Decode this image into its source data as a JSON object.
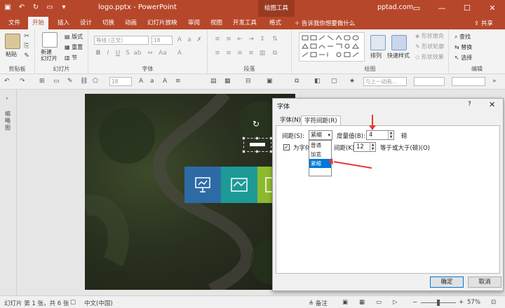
{
  "titlebar": {
    "title": "logo.pptx  -  PowerPoint",
    "context_tool": "绘图工具",
    "account": "pptad.com",
    "accent": "#b7472a"
  },
  "tabs": [
    "文件",
    "开始",
    "插入",
    "设计",
    "切换",
    "动画",
    "幻灯片放映",
    "审阅",
    "视图",
    "开发工具",
    "格式"
  ],
  "active_tab": "开始",
  "tell_me": "告诉我你想要做什么",
  "share": "共享",
  "ribbon": {
    "clipboard": {
      "label": "剪贴板",
      "paste": "粘贴"
    },
    "slides": {
      "label": "幻灯片",
      "new_slide": "新建\n幻灯片",
      "layout": "版式",
      "reset": "重置",
      "section": "节"
    },
    "font": {
      "label": "字体",
      "font_name": "等线 (正文)",
      "font_size": "18"
    },
    "paragraph": {
      "label": "段落"
    },
    "drawing": {
      "label": "绘图",
      "arrange": "排列",
      "quick_styles": "快速样式",
      "fill": "形状填充",
      "outline": "形状轮廓",
      "effects": "形状效果"
    },
    "editing": {
      "label": "编辑",
      "find": "查找",
      "replace": "替换",
      "select": "选择"
    }
  },
  "toolbar2": {
    "font_size": "18",
    "animation": "与上一动画..."
  },
  "left_pane_label": "缩略图",
  "dialog": {
    "title": "字体",
    "help": "?",
    "close": "✕",
    "tabs": [
      "字体(N)",
      "字符间距(R)"
    ],
    "active_tab": "字符间距(R)",
    "spacing_label": "间距(S):",
    "spacing_value": "紧缩",
    "spacing_options": [
      "普通",
      "加宽",
      "紧缩"
    ],
    "highlighted_option": "紧缩",
    "measure_label": "度量值(B):",
    "measure_value": "4",
    "measure_unit": "磅",
    "kerning_label": "为字体",
    "kerning_label2": "间距(K):",
    "kerning_checked": true,
    "kerning_value": "12",
    "kerning_suffix": "等于或大于(磅)(O)",
    "ok": "确定",
    "cancel": "取消"
  },
  "status": {
    "slide_info": "幻灯片 第 1 张，共 6 张",
    "language": "中文(中国)",
    "notes": "备注",
    "zoom": "57%",
    "zoom_level": 0.57
  },
  "colors": {
    "tile1": "#2d6ba6",
    "tile2": "#1d9a96",
    "tile3": "#8fb92d",
    "annotation": "#e53935"
  }
}
